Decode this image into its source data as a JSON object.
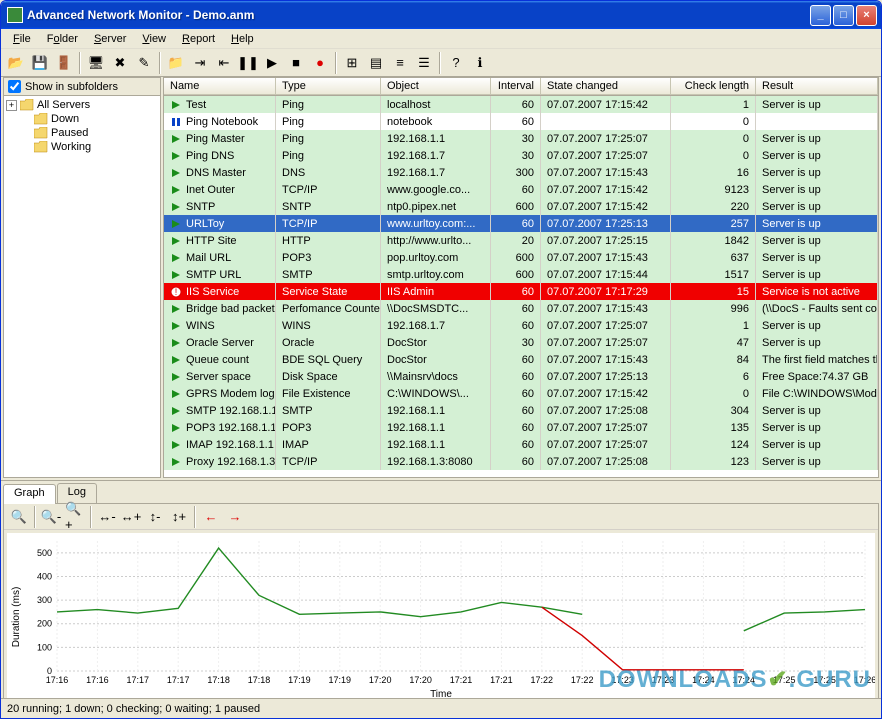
{
  "window": {
    "title": "Advanced Network Monitor - Demo.anm"
  },
  "menu": {
    "items": [
      {
        "label": "File",
        "u": "F"
      },
      {
        "label": "Folder",
        "u": "o"
      },
      {
        "label": "Server",
        "u": "S"
      },
      {
        "label": "View",
        "u": "V"
      },
      {
        "label": "Report",
        "u": "R"
      },
      {
        "label": "Help",
        "u": "H"
      }
    ]
  },
  "toolbar_icons": [
    "open-icon",
    "save-icon",
    "exit-icon",
    "sep",
    "new-server-icon",
    "delete-icon",
    "edit-icon",
    "sep",
    "folder-icon",
    "move-in-icon",
    "move-out-icon",
    "pause-icon",
    "resume-icon",
    "stop-icon",
    "record-icon",
    "sep",
    "large-icons-icon",
    "small-icons-icon",
    "list-icon",
    "details-icon",
    "sep",
    "help-icon",
    "about-icon"
  ],
  "tree": {
    "show_subfolders_label": "Show in subfolders",
    "show_subfolders_checked": true,
    "root": "All Servers",
    "children": [
      "Down",
      "Paused",
      "Working"
    ]
  },
  "columns": [
    "Name",
    "Type",
    "Object",
    "Interval",
    "State changed",
    "Check length",
    "Result"
  ],
  "rows": [
    {
      "s": "up",
      "sel": false,
      "name": "Test",
      "type": "Ping",
      "obj": "localhost",
      "intv": "60",
      "state": "07.07.2007 17:15:42",
      "len": "1",
      "res": "Server is up"
    },
    {
      "s": "pause",
      "sel": false,
      "name": "Ping Notebook",
      "type": "Ping",
      "obj": "notebook",
      "intv": "60",
      "state": "",
      "len": "0",
      "res": ""
    },
    {
      "s": "up",
      "sel": false,
      "name": "Ping Master",
      "type": "Ping",
      "obj": "192.168.1.1",
      "intv": "30",
      "state": "07.07.2007 17:25:07",
      "len": "0",
      "res": "Server is up"
    },
    {
      "s": "up",
      "sel": false,
      "name": "Ping DNS",
      "type": "Ping",
      "obj": "192.168.1.7",
      "intv": "30",
      "state": "07.07.2007 17:25:07",
      "len": "0",
      "res": "Server is up"
    },
    {
      "s": "up",
      "sel": false,
      "name": "DNS Master",
      "type": "DNS",
      "obj": "192.168.1.7",
      "intv": "300",
      "state": "07.07.2007 17:15:43",
      "len": "16",
      "res": "Server is up"
    },
    {
      "s": "up",
      "sel": false,
      "name": "Inet Outer",
      "type": "TCP/IP",
      "obj": "www.google.co...",
      "intv": "60",
      "state": "07.07.2007 17:15:42",
      "len": "9123",
      "res": "Server is up"
    },
    {
      "s": "up",
      "sel": false,
      "name": "SNTP",
      "type": "SNTP",
      "obj": "ntp0.pipex.net",
      "intv": "600",
      "state": "07.07.2007 17:15:42",
      "len": "220",
      "res": "Server is up"
    },
    {
      "s": "up",
      "sel": true,
      "name": "URLToy",
      "type": "TCP/IP",
      "obj": "www.urltoy.com:...",
      "intv": "60",
      "state": "07.07.2007 17:25:13",
      "len": "257",
      "res": "Server is up"
    },
    {
      "s": "up",
      "sel": false,
      "name": "HTTP Site",
      "type": "HTTP",
      "obj": "http://www.urlto...",
      "intv": "20",
      "state": "07.07.2007 17:25:15",
      "len": "1842",
      "res": "Server is up"
    },
    {
      "s": "up",
      "sel": false,
      "name": "Mail URL",
      "type": "POP3",
      "obj": "pop.urltoy.com",
      "intv": "600",
      "state": "07.07.2007 17:15:43",
      "len": "637",
      "res": "Server is up"
    },
    {
      "s": "up",
      "sel": false,
      "name": "SMTP URL",
      "type": "SMTP",
      "obj": "smtp.urltoy.com",
      "intv": "600",
      "state": "07.07.2007 17:15:44",
      "len": "1517",
      "res": "Server is up"
    },
    {
      "s": "down",
      "sel": false,
      "name": "IIS Service",
      "type": "Service State",
      "obj": "IIS Admin",
      "intv": "60",
      "state": "07.07.2007 17:17:29",
      "len": "15",
      "res": "Service is not active"
    },
    {
      "s": "up",
      "sel": false,
      "name": "Bridge bad packets",
      "type": "Perfomance Counter",
      "obj": "\\\\DocSMSDTC...",
      "intv": "60",
      "state": "07.07.2007 17:15:43",
      "len": "996",
      "res": "(\\\\DocS - Faults sent count/sec ..."
    },
    {
      "s": "up",
      "sel": false,
      "name": "WINS",
      "type": "WINS",
      "obj": "192.168.1.7",
      "intv": "60",
      "state": "07.07.2007 17:25:07",
      "len": "1",
      "res": "Server is up"
    },
    {
      "s": "up",
      "sel": false,
      "name": "Oracle Server",
      "type": "Oracle",
      "obj": "DocStor",
      "intv": "30",
      "state": "07.07.2007 17:25:07",
      "len": "47",
      "res": "Server is up"
    },
    {
      "s": "up",
      "sel": false,
      "name": "Queue count",
      "type": "BDE SQL Query",
      "obj": "DocStor",
      "intv": "60",
      "state": "07.07.2007 17:15:43",
      "len": "84",
      "res": "The first field matches the conditi..."
    },
    {
      "s": "up",
      "sel": false,
      "name": "Server space",
      "type": "Disk Space",
      "obj": "\\\\Mainsrv\\docs",
      "intv": "60",
      "state": "07.07.2007 17:25:13",
      "len": "6",
      "res": "Free Space:74.37 GB"
    },
    {
      "s": "up",
      "sel": false,
      "name": "GPRS Modem log",
      "type": "File Existence",
      "obj": "C:\\WINDOWS\\...",
      "intv": "60",
      "state": "07.07.2007 17:15:42",
      "len": "0",
      "res": "File C:\\WINDOWS\\ModemLog_..."
    },
    {
      "s": "up",
      "sel": false,
      "name": "SMTP 192.168.1.1",
      "type": "SMTP",
      "obj": "192.168.1.1",
      "intv": "60",
      "state": "07.07.2007 17:25:08",
      "len": "304",
      "res": "Server is up"
    },
    {
      "s": "up",
      "sel": false,
      "name": "POP3 192.168.1.1",
      "type": "POP3",
      "obj": "192.168.1.1",
      "intv": "60",
      "state": "07.07.2007 17:25:07",
      "len": "135",
      "res": "Server is up"
    },
    {
      "s": "up",
      "sel": false,
      "name": "IMAP 192.168.1.1",
      "type": "IMAP",
      "obj": "192.168.1.1",
      "intv": "60",
      "state": "07.07.2007 17:25:07",
      "len": "124",
      "res": "Server is up"
    },
    {
      "s": "up",
      "sel": false,
      "name": "Proxy 192.168.1.3",
      "type": "TCP/IP",
      "obj": "192.168.1.3:8080",
      "intv": "60",
      "state": "07.07.2007 17:25:08",
      "len": "123",
      "res": "Server is up"
    }
  ],
  "bottom_tabs": [
    "Graph",
    "Log"
  ],
  "graph_toolbar": [
    "zoom-reset-icon",
    "sep",
    "zoom-out-icon",
    "zoom-in-icon",
    "sep",
    "zoom-out-x-icon",
    "zoom-in-x-icon",
    "zoom-out-y-icon",
    "zoom-in-y-icon",
    "sep",
    "arrow-left-icon",
    "arrow-right-icon"
  ],
  "chart_data": {
    "type": "line",
    "xlabel": "Time",
    "ylabel": "Duration (ms)",
    "ylim": [
      0,
      550
    ],
    "categories": [
      "17:16",
      "17:16",
      "17:17",
      "17:17",
      "17:18",
      "17:18",
      "17:19",
      "17:19",
      "17:20",
      "17:20",
      "17:21",
      "17:21",
      "17:22",
      "17:22",
      "17:23",
      "17:23",
      "17:24",
      "17:24",
      "17:25",
      "17:25",
      "17:26"
    ],
    "series": [
      {
        "name": "URLToy",
        "color": "#228b22",
        "values": [
          250,
          260,
          245,
          265,
          520,
          320,
          240,
          245,
          250,
          230,
          250,
          290,
          270,
          240,
          null,
          null,
          null,
          170,
          245,
          250,
          260
        ]
      },
      {
        "name": "IIS Service",
        "color": "#d00000",
        "values": [
          null,
          null,
          null,
          null,
          null,
          null,
          null,
          null,
          null,
          null,
          null,
          null,
          270,
          150,
          5,
          5,
          5,
          5,
          null,
          null,
          null
        ]
      }
    ]
  },
  "statusbar": "20 running; 1 down; 0 checking; 0 waiting; 1 paused",
  "watermark": {
    "a": "DOWNLOADS",
    "b": ".GURU"
  }
}
